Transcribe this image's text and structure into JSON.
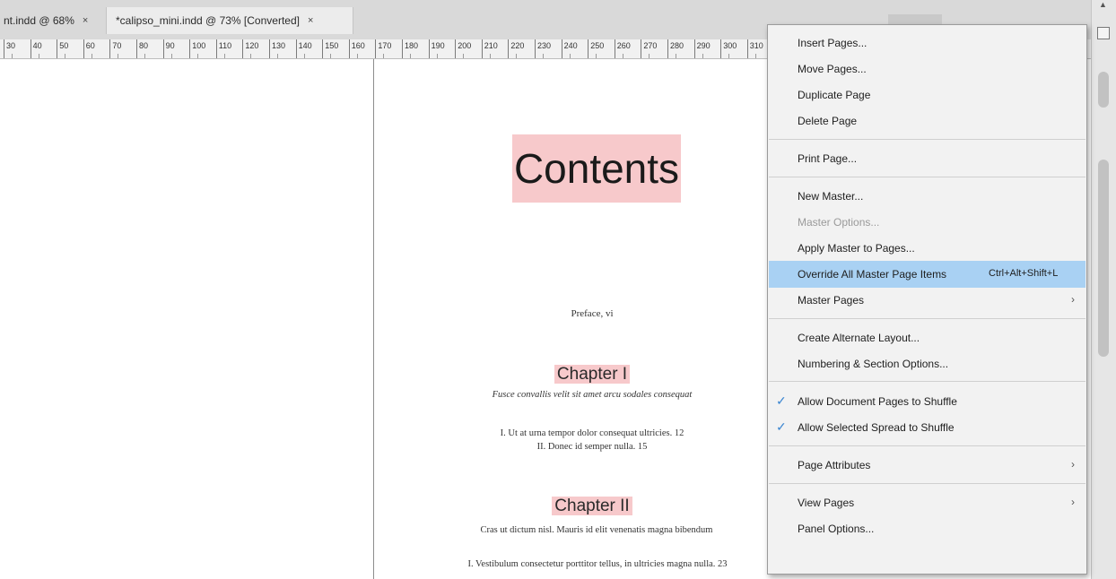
{
  "tabs": [
    {
      "label": "nt.indd @ 68%",
      "close": "×"
    },
    {
      "label": "*calipso_mini.indd @ 73% [Converted]",
      "close": "×"
    }
  ],
  "ruler": {
    "ticks": [
      "30",
      "40",
      "50",
      "60",
      "70",
      "80",
      "90",
      "100",
      "110",
      "120",
      "130",
      "140",
      "150",
      "160",
      "170",
      "180",
      "190",
      "200",
      "210",
      "220",
      "230",
      "240",
      "250",
      "260",
      "270",
      "280",
      "290",
      "300",
      "310"
    ]
  },
  "document": {
    "title": "Contents",
    "preface": "Preface, vi",
    "chapters": [
      {
        "heading": "Chapter I",
        "summary": "Fusce convallis velit sit amet arcu sodales consequat",
        "items": [
          "I. Ut at urna tempor dolor consequat ultricies. 12",
          "II. Donec id semper nulla. 15"
        ]
      },
      {
        "heading": "Chapter II",
        "summary": "Cras ut dictum nisl. Mauris id elit venenatis magna bibendum",
        "items": [
          "I. Vestibulum consectetur porttitor tellus, in ultricies magna nulla. 23"
        ]
      }
    ]
  },
  "menu": {
    "items": [
      {
        "label": "Insert Pages...",
        "shortcut": "",
        "submenu": false,
        "checked": false,
        "disabled": false,
        "highlighted": false
      },
      {
        "label": "Move Pages...",
        "shortcut": "",
        "submenu": false,
        "checked": false,
        "disabled": false,
        "highlighted": false
      },
      {
        "label": "Duplicate Page",
        "shortcut": "",
        "submenu": false,
        "checked": false,
        "disabled": false,
        "highlighted": false
      },
      {
        "label": "Delete Page",
        "shortcut": "",
        "submenu": false,
        "checked": false,
        "disabled": false,
        "highlighted": false
      },
      {
        "label": "Print Page...",
        "shortcut": "",
        "submenu": false,
        "checked": false,
        "disabled": false,
        "highlighted": false
      },
      {
        "label": "New Master...",
        "shortcut": "",
        "submenu": false,
        "checked": false,
        "disabled": false,
        "highlighted": false
      },
      {
        "label": "Master Options...",
        "shortcut": "",
        "submenu": false,
        "checked": false,
        "disabled": true,
        "highlighted": false
      },
      {
        "label": "Apply Master to Pages...",
        "shortcut": "",
        "submenu": false,
        "checked": false,
        "disabled": false,
        "highlighted": false
      },
      {
        "label": "Override All Master Page Items",
        "shortcut": "Ctrl+Alt+Shift+L",
        "submenu": false,
        "checked": false,
        "disabled": false,
        "highlighted": true
      },
      {
        "label": "Master Pages",
        "shortcut": "",
        "submenu": true,
        "checked": false,
        "disabled": false,
        "highlighted": false
      },
      {
        "label": "Create Alternate Layout...",
        "shortcut": "",
        "submenu": false,
        "checked": false,
        "disabled": false,
        "highlighted": false
      },
      {
        "label": "Numbering & Section Options...",
        "shortcut": "",
        "submenu": false,
        "checked": false,
        "disabled": false,
        "highlighted": false
      },
      {
        "label": "Allow Document Pages to Shuffle",
        "shortcut": "",
        "submenu": false,
        "checked": true,
        "disabled": false,
        "highlighted": false
      },
      {
        "label": "Allow Selected Spread to Shuffle",
        "shortcut": "",
        "submenu": false,
        "checked": true,
        "disabled": false,
        "highlighted": false
      },
      {
        "label": "Page Attributes",
        "shortcut": "",
        "submenu": true,
        "checked": false,
        "disabled": false,
        "highlighted": false
      },
      {
        "label": "View Pages",
        "shortcut": "",
        "submenu": true,
        "checked": false,
        "disabled": false,
        "highlighted": false
      },
      {
        "label": "Panel Options...",
        "shortcut": "",
        "submenu": false,
        "checked": false,
        "disabled": false,
        "highlighted": false
      }
    ],
    "submenu_arrow": "›",
    "check_mark": "✓"
  },
  "colors": {
    "highlight": "#a9d1f3",
    "title_bg": "#f7c9cb",
    "check": "#3b86d1"
  }
}
